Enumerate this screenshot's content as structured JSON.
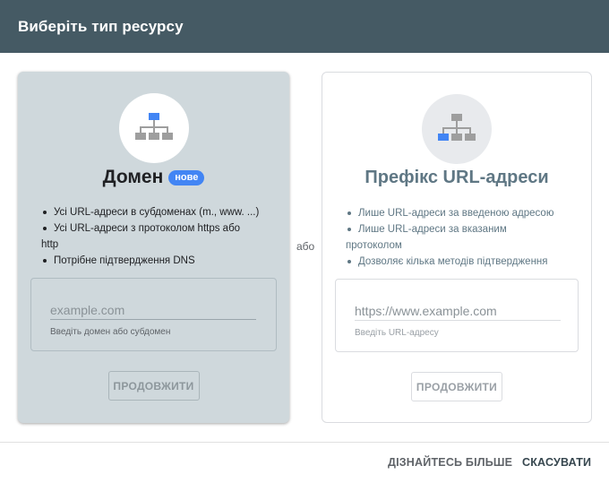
{
  "dialog": {
    "title": "Виберіть тип ресурсу"
  },
  "domain_card": {
    "title": "Домен",
    "badge": "нове",
    "features": [
      "Усі URL-адреси в субдоменах (m., www. ...)",
      "Усі URL-адреси з протоколом https або",
      "http",
      "Потрібне підтвердження DNS"
    ],
    "input_value": "",
    "input_placeholder": "example.com",
    "helper_text": "Введіть домен або субдомен",
    "continue_label": "ПРОДОВЖИТИ",
    "icon": "sitemap-icon"
  },
  "separator": {
    "or_label": "або"
  },
  "prefix_card": {
    "title": "Префікс URL-адреси",
    "features": [
      "Лише URL-адреси за введеною адресою",
      "Лише URL-адреси за вказаним",
      "протоколом",
      "Дозволяє кілька методів підтвердження"
    ],
    "input_value": "",
    "input_placeholder": "https://www.example.com",
    "helper_text": "Введіть URL-адресу",
    "continue_label": "ПРОДОВЖИТИ",
    "icon": "sitemap-icon"
  },
  "footer": {
    "learn_more_label": "ДІЗНАЙТЕСЬ БІЛЬШЕ",
    "cancel_label": "СКАСУВАТИ"
  },
  "colors": {
    "header_bg": "#455a64",
    "accent_blue": "#4285f4",
    "domain_card_bg": "#cfd8dc"
  }
}
